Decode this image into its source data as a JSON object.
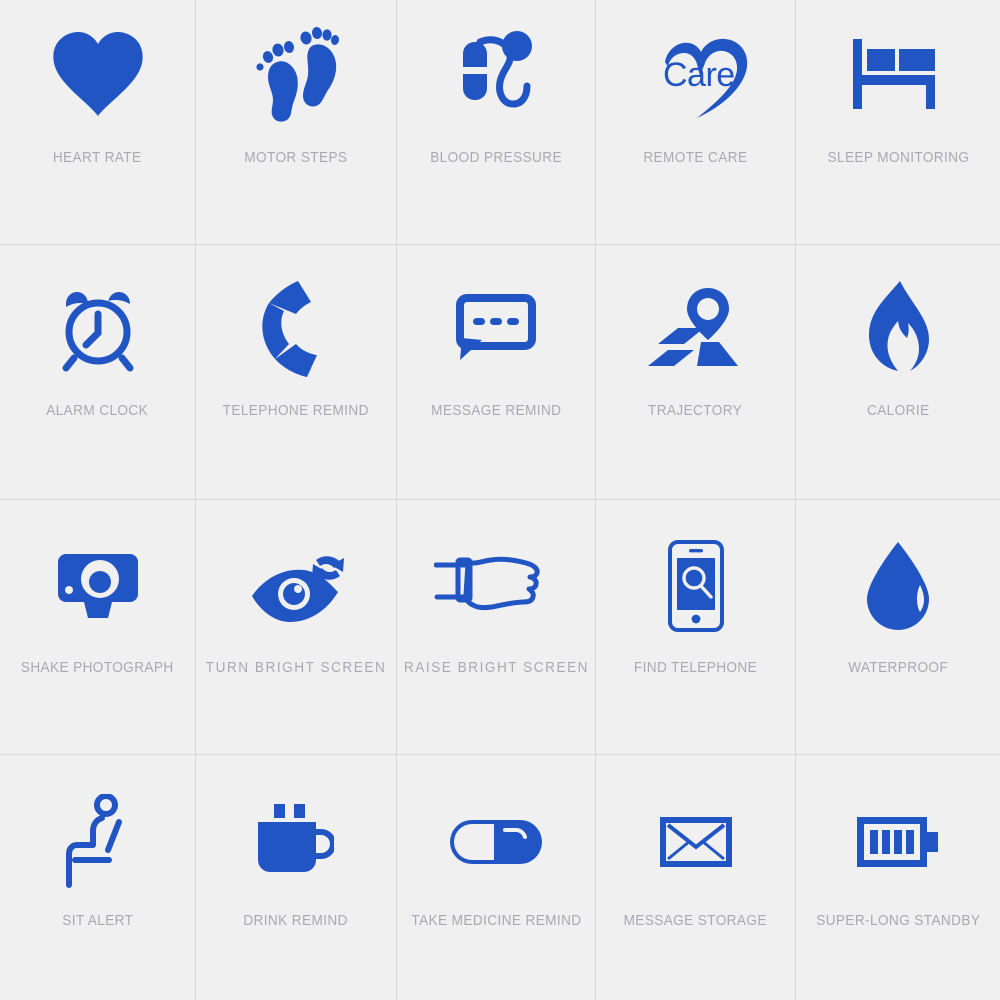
{
  "theme": {
    "background": "#f0f0f0",
    "grid_line": "#d8d8d8",
    "icon_blue": "#2255c4",
    "label_gray": "#a9a9b2"
  },
  "grid": {
    "columns": 5,
    "rows": 4
  },
  "features": [
    {
      "id": "heart-rate",
      "label": "HEART RATE",
      "icon": "heart-icon"
    },
    {
      "id": "motor-steps",
      "label": "MOTOR STEPS",
      "icon": "footprints-icon"
    },
    {
      "id": "blood-pressure",
      "label": "BLOOD PRESSURE",
      "icon": "blood-pressure-cuff-icon"
    },
    {
      "id": "remote-care",
      "label": "REMOTE CARE",
      "icon": "care-heart-logo-icon",
      "logo_text": "Care"
    },
    {
      "id": "sleep-monitoring",
      "label": "SLEEP MONITORING",
      "icon": "bed-icon"
    },
    {
      "id": "alarm-clock",
      "label": "ALARM CLOCK",
      "icon": "alarm-clock-icon"
    },
    {
      "id": "telephone-remind",
      "label": "TELEPHONE REMIND",
      "icon": "phone-handset-icon"
    },
    {
      "id": "message-remind",
      "label": "MESSAGE REMIND",
      "icon": "chat-bubble-icon"
    },
    {
      "id": "trajectory",
      "label": "TRAJECTORY",
      "icon": "map-pin-route-icon"
    },
    {
      "id": "calorie",
      "label": "CALORIE",
      "icon": "flame-icon"
    },
    {
      "id": "shake-photograph",
      "label": "SHAKE PHOTOGRAPH",
      "icon": "camera-icon"
    },
    {
      "id": "turn-bright-screen",
      "label": "TURN  BRIGHT  SCREEN",
      "icon": "eye-refresh-icon"
    },
    {
      "id": "raise-bright-screen",
      "label": "RAISE  BRIGHT  SCREEN",
      "icon": "wrist-watch-hand-icon"
    },
    {
      "id": "find-telephone",
      "label": "FIND TELEPHONE",
      "icon": "phone-search-icon"
    },
    {
      "id": "waterproof",
      "label": "WATERPROOF",
      "icon": "water-drop-icon"
    },
    {
      "id": "sit-alert",
      "label": "SIT ALERT",
      "icon": "seated-person-icon"
    },
    {
      "id": "drink-remind",
      "label": "DRINK  REMIND",
      "icon": "coffee-mug-icon"
    },
    {
      "id": "take-medicine-remind",
      "label": "TAKE MEDICINE REMIND",
      "icon": "pill-capsule-icon"
    },
    {
      "id": "message-storage",
      "label": "MESSAGE STORAGE",
      "icon": "envelope-icon"
    },
    {
      "id": "super-long-standby",
      "label": "SUPER-LONG STANDBY",
      "icon": "battery-icon"
    }
  ]
}
